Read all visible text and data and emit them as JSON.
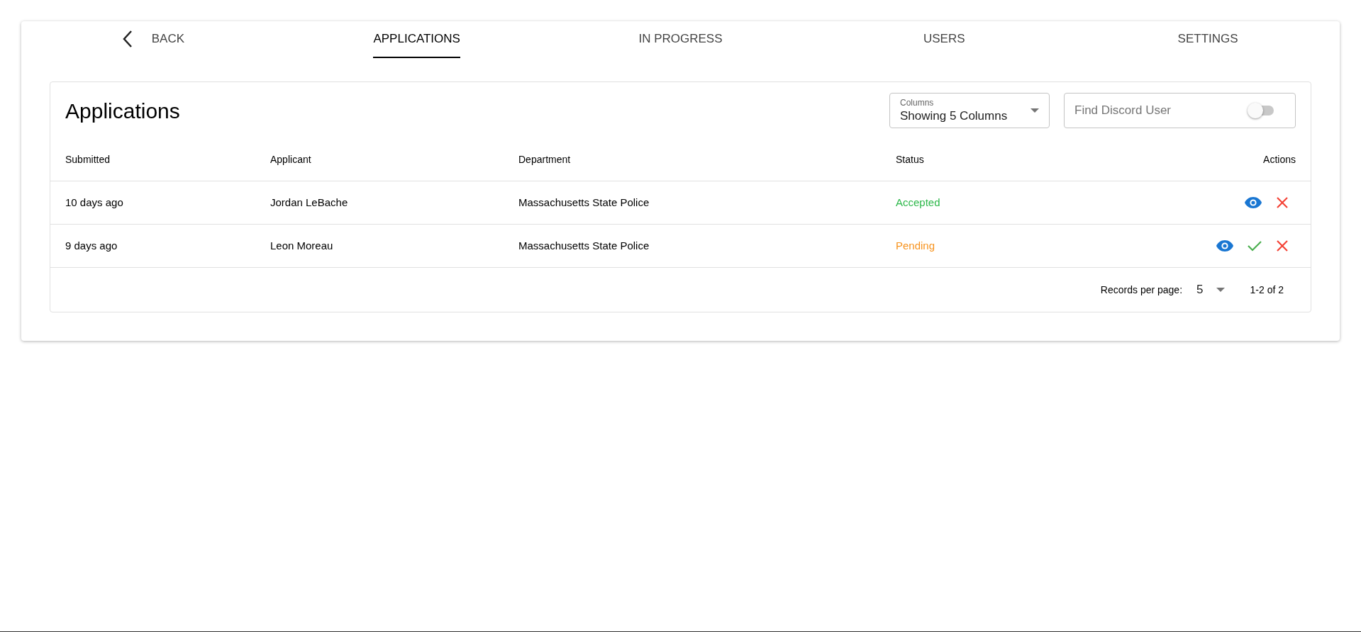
{
  "nav": {
    "back": {
      "label": "BACK"
    },
    "tabs": [
      {
        "label": "APPLICATIONS",
        "selected": true
      },
      {
        "label": "IN PROGRESS",
        "selected": false
      },
      {
        "label": "USERS",
        "selected": false
      },
      {
        "label": "SETTINGS",
        "selected": false
      }
    ]
  },
  "table": {
    "title": "Applications",
    "columns_select": {
      "label": "Columns",
      "value": "Showing 5 Columns"
    },
    "search": {
      "placeholder": "Find Discord User",
      "toggle_on": false
    },
    "columns": [
      "Submitted",
      "Applicant",
      "Department",
      "Status",
      "Actions"
    ],
    "rows": [
      {
        "submitted": "10 days ago",
        "applicant": "Jordan LeBache",
        "department": "Massachusetts State Police",
        "status": {
          "text": "Accepted",
          "kind": "accepted"
        },
        "actions": [
          {
            "kind": "view"
          },
          {
            "kind": "reject"
          }
        ]
      },
      {
        "submitted": "9 days ago",
        "applicant": "Leon Moreau",
        "department": "Massachusetts State Police",
        "status": {
          "text": "Pending",
          "kind": "pending"
        },
        "actions": [
          {
            "kind": "view"
          },
          {
            "kind": "approve"
          },
          {
            "kind": "reject"
          }
        ]
      }
    ],
    "footer": {
      "rows_label": "Records per page:",
      "rows_per_page": "5",
      "range": "1-2 of 2"
    }
  }
}
